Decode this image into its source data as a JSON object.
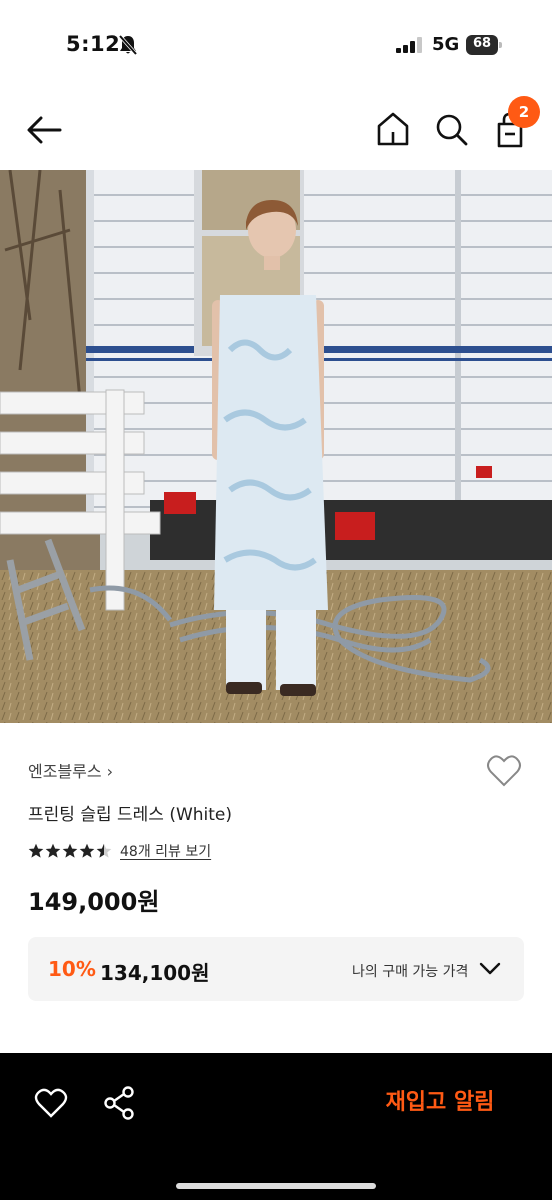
{
  "status_bar": {
    "time": "5:12",
    "network": "5G",
    "battery": "68"
  },
  "header": {
    "icons": [
      "arrow-left-icon",
      "home-icon",
      "search-icon",
      "bag-icon"
    ],
    "cart_count": "2"
  },
  "product": {
    "brand": "엔조블루스 ›",
    "name": "프린팅 슬립 드레스 (White)",
    "rating": 4.5,
    "review_link": "48개 리뷰 보기",
    "price": "149,000원"
  },
  "my_price": {
    "discount_rate": "10%",
    "discount_price": "134,100원",
    "label": "나의 구매 가능 가격"
  },
  "bottom_bar": {
    "restock_label": "재입고 알림"
  },
  "colors": {
    "accent": "#ff5a14",
    "bottom_bar_bg": "#000000"
  }
}
